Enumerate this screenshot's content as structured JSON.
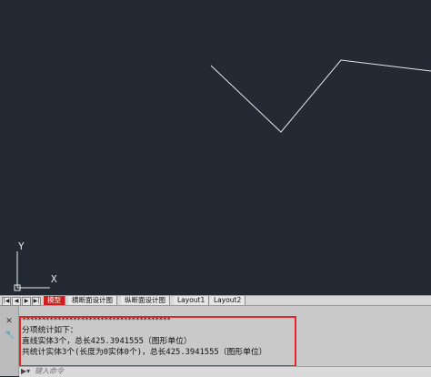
{
  "layout_tabs": {
    "tabs": [
      {
        "label": "模型",
        "active": true
      },
      {
        "label": "横断面设计图",
        "active": false
      },
      {
        "label": "纵断面设计图",
        "active": false
      },
      {
        "label": "Layout1",
        "active": false
      },
      {
        "label": "Layout2",
        "active": false
      }
    ],
    "nav_buttons": [
      "|◀",
      "◀",
      "▶",
      "▶|"
    ]
  },
  "ucs_icon": {
    "y_label": "Y",
    "x_label": "X"
  },
  "command_window": {
    "history": {
      "separator": "**************************************",
      "lines": [
        "分项统计如下：",
        "直线实体3个，总长425.3941555（图形单位）",
        "共统计实体3个(长度为0实体0个)，总长425.3941555（图形单位）"
      ]
    },
    "prompt_placeholder": "键入命令"
  },
  "colors": {
    "canvas_background": "#232a34",
    "polyline": "#e6e6e6",
    "active_tab": "#cc1f1f",
    "highlight_box": "#e0262a"
  }
}
